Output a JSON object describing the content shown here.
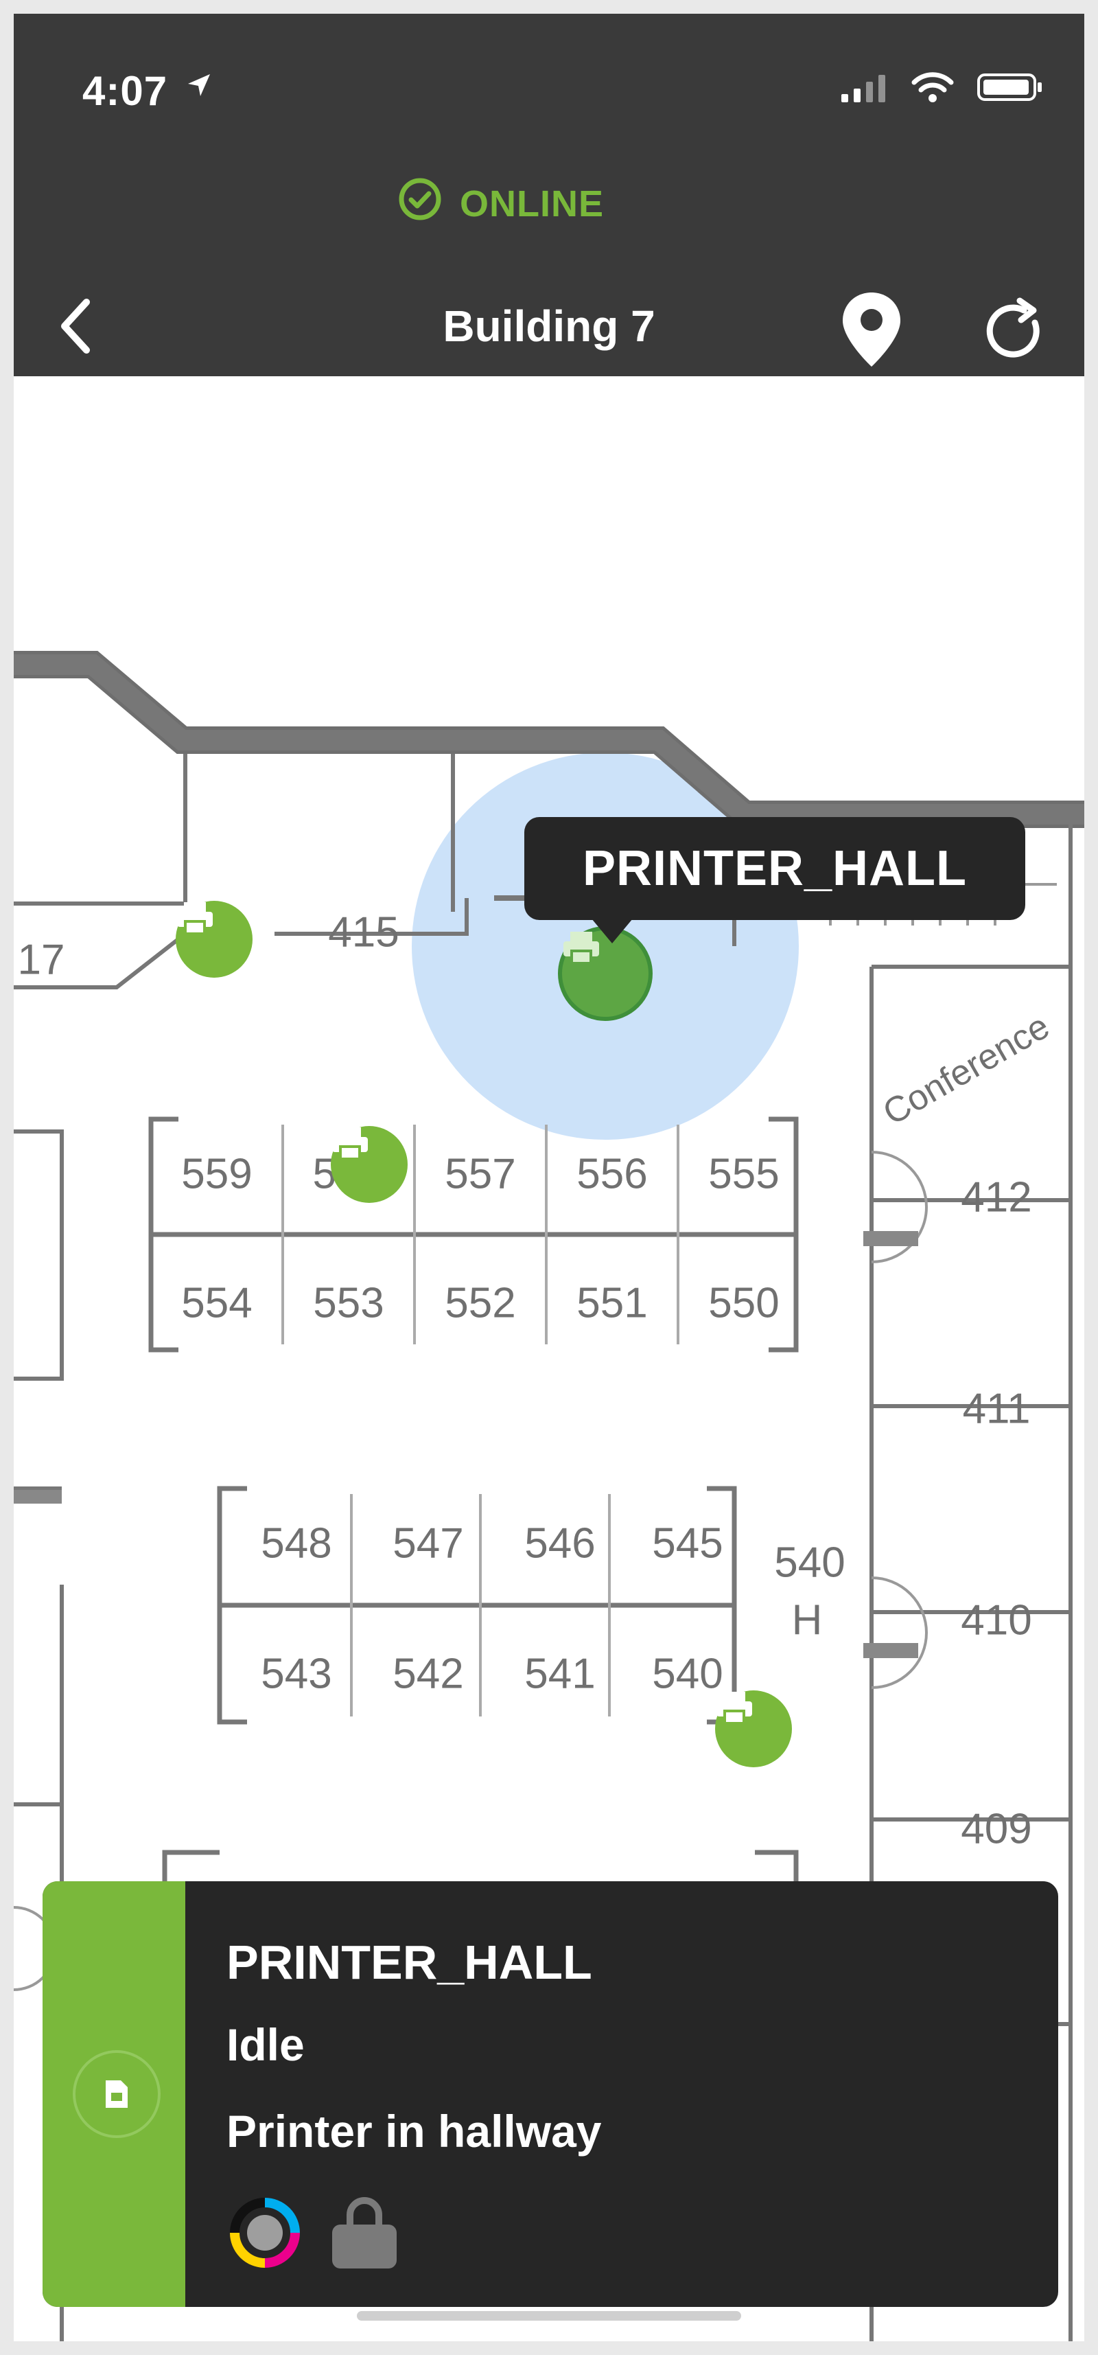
{
  "status_bar": {
    "time": "4:07"
  },
  "header": {
    "connection_status": "ONLINE",
    "title": "Building 7",
    "back_icon": "chevron-left-icon",
    "location_icon": "map-pin-icon",
    "refresh_icon": "refresh-icon"
  },
  "map": {
    "rooms": {
      "r417": "17",
      "r415": "415",
      "r559": "559",
      "r558": "55",
      "r557": "557",
      "r556": "556",
      "r555": "555",
      "r554": "554",
      "r553": "553",
      "r552": "552",
      "r551": "551",
      "r550": "550",
      "r548": "548",
      "r547": "547",
      "r546": "546",
      "r545": "545",
      "r543": "543",
      "r542": "542",
      "r541": "541",
      "r540": "540",
      "r540h_a": "540",
      "r540h_b": "H",
      "r412": "412",
      "r411": "411",
      "r410": "410",
      "r409": "409",
      "conference": "Conference"
    },
    "selected_tooltip": "PRINTER_HALL"
  },
  "printer_card": {
    "name": "PRINTER_HALL",
    "status": "Idle",
    "description": "Printer in hallway"
  },
  "colors": {
    "accent": "#7ab83b",
    "dark": "#262626",
    "header": "#3a3a3a"
  }
}
